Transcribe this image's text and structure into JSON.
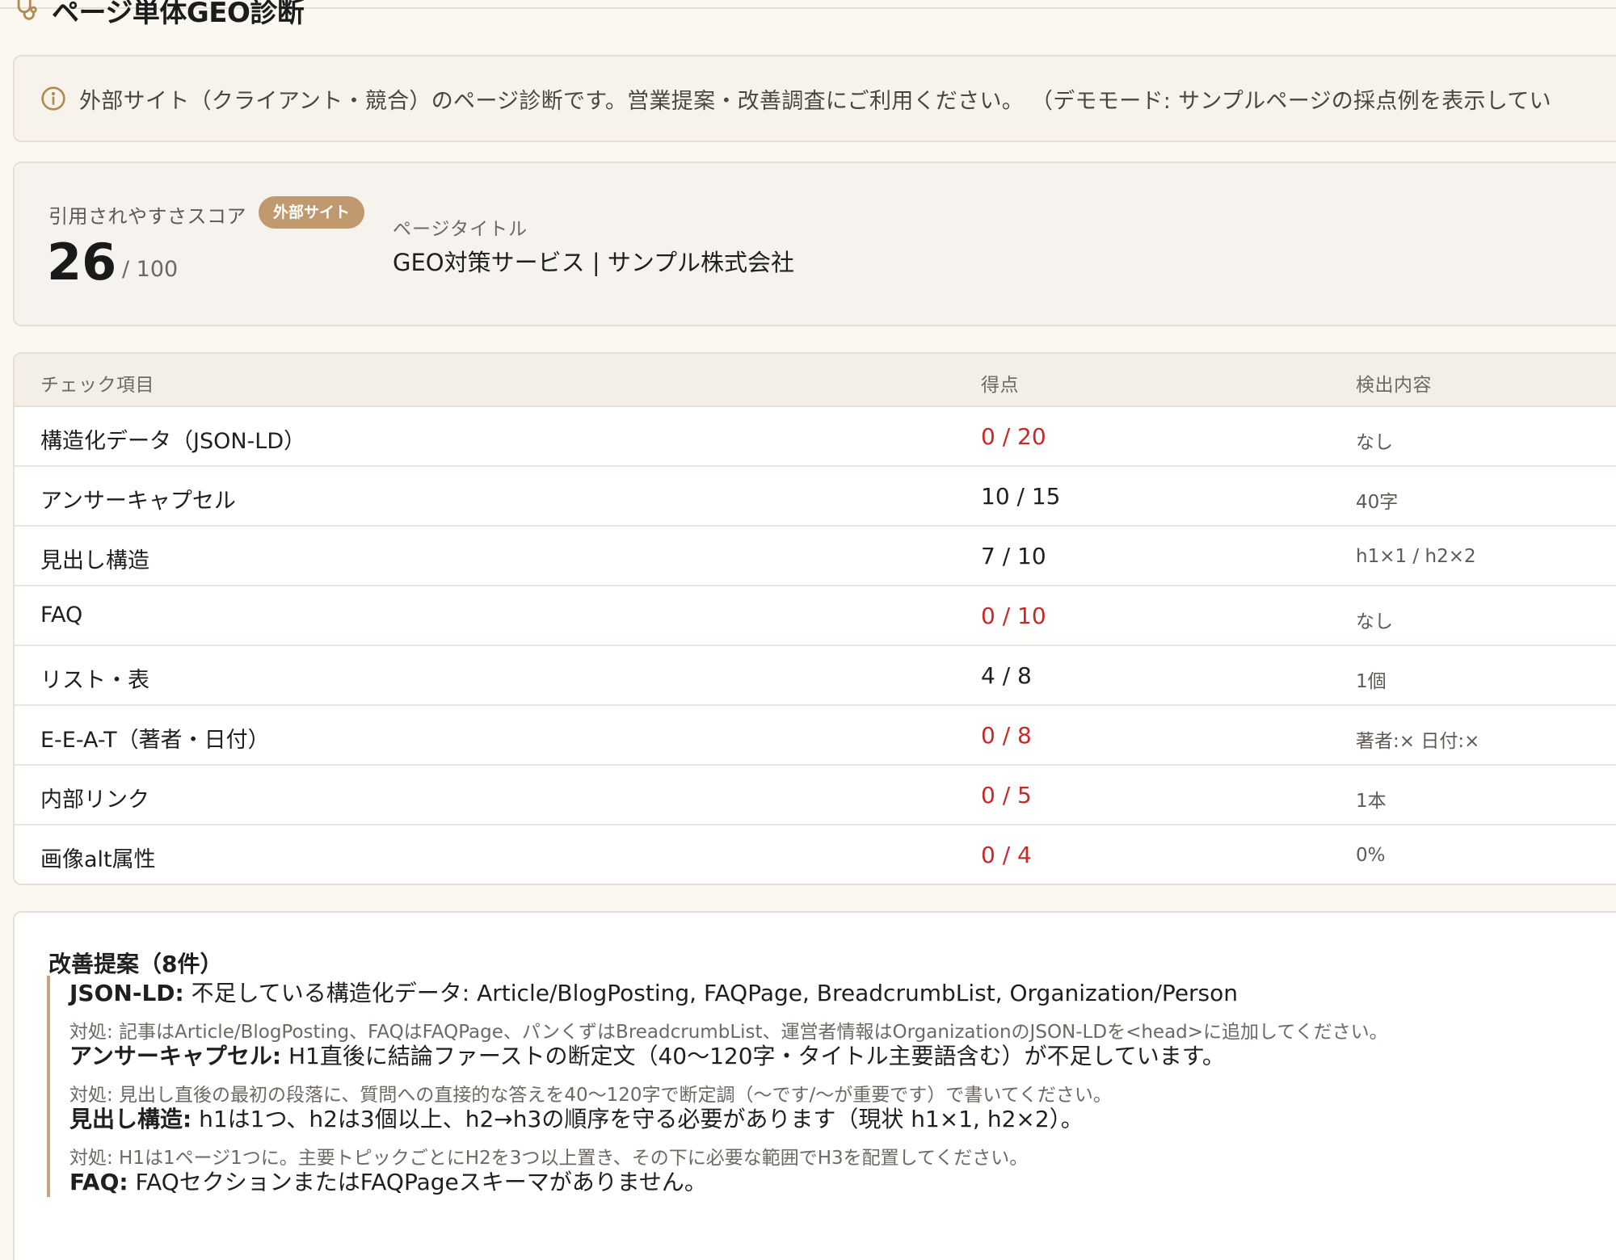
{
  "header": {
    "title": "ページ単体GEO診断",
    "icon": "stethoscope-icon"
  },
  "notice": {
    "icon": "info-icon",
    "text": "外部サイト（クライアント・競合）のページ診断です。営業提案・改善調査にご利用ください。 （デモモード: サンプルページの採点例を表示してい"
  },
  "score": {
    "label": "引用されやすさスコア",
    "badge": "外部サイト",
    "value": "26",
    "max": "/ 100",
    "page_title_label": "ページタイトル",
    "page_title": "GEO対策サービス | サンプル株式会社"
  },
  "table": {
    "headers": [
      "チェック項目",
      "得点",
      "検出内容"
    ],
    "rows": [
      {
        "item": "構造化データ（JSON-LD）",
        "score": "0 / 20",
        "zero": true,
        "detected": "なし"
      },
      {
        "item": "アンサーキャプセル",
        "score": "10 / 15",
        "zero": false,
        "detected": "40字"
      },
      {
        "item": "見出し構造",
        "score": "7 / 10",
        "zero": false,
        "detected": "h1×1 / h2×2"
      },
      {
        "item": "FAQ",
        "score": "0 / 10",
        "zero": true,
        "detected": "なし"
      },
      {
        "item": "リスト・表",
        "score": "4 / 8",
        "zero": false,
        "detected": "1個"
      },
      {
        "item": "E-E-A-T（著者・日付）",
        "score": "0 / 8",
        "zero": true,
        "detected": "著者:× 日付:×"
      },
      {
        "item": "内部リンク",
        "score": "0 / 5",
        "zero": true,
        "detected": "1本"
      },
      {
        "item": "画像alt属性",
        "score": "0 / 4",
        "zero": true,
        "detected": "0%"
      }
    ]
  },
  "suggestions": {
    "title": "改善提案（8件）",
    "items": [
      {
        "label": "JSON-LD:",
        "text": " 不足している構造化データ: Article/BlogPosting, FAQPage, BreadcrumbList, Organization/Person",
        "fix": "対処: 記事はArticle/BlogPosting、FAQはFAQPage、パンくずはBreadcrumbList、運営者情報はOrganizationのJSON-LDを<head>に追加してください。"
      },
      {
        "label": "アンサーキャプセル:",
        "text": " H1直後に結論ファーストの断定文（40〜120字・タイトル主要語含む）が不足しています。",
        "fix": "対処: 見出し直後の最初の段落に、質問への直接的な答えを40〜120字で断定調（〜です/〜が重要です）で書いてください。"
      },
      {
        "label": "見出し構造:",
        "text": " h1は1つ、h2は3個以上、h2→h3の順序を守る必要があります（現状 h1×1, h2×2）。",
        "fix": "対処: H1は1ページ1つに。主要トピックごとにH2を3つ以上置き、その下に必要な範囲でH3を配置してください。"
      },
      {
        "label": "FAQ:",
        "text": " FAQセクションまたはFAQPageスキーマがありません。",
        "fix": ""
      }
    ]
  },
  "colors": {
    "accent": "#c09a6e",
    "zero_score": "#c62a28",
    "background": "#fbf8f1"
  }
}
